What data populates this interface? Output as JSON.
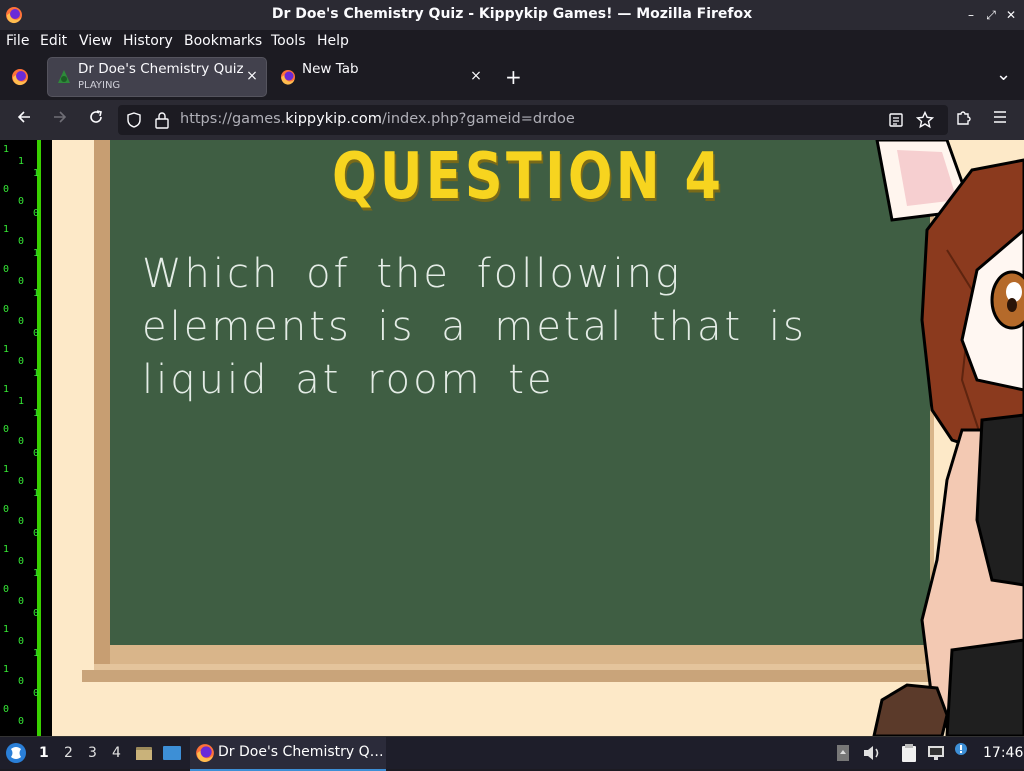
{
  "window": {
    "title": "Dr Doe's Chemistry Quiz - Kippykip Games! — Mozilla Firefox",
    "minimize_glyph": "–",
    "restore_glyph": "⤢",
    "close_glyph": "✕"
  },
  "menu": {
    "file": "File",
    "edit": "Edit",
    "view": "View",
    "history": "History",
    "bookmarks": "Bookmarks",
    "tools": "Tools",
    "help": "Help"
  },
  "tabs": [
    {
      "label": "Dr Doe's Chemistry Quiz",
      "sublabel": "PLAYING",
      "active": true
    },
    {
      "label": "New Tab",
      "active": false
    }
  ],
  "tab_glyphs": {
    "close": "×",
    "new": "+",
    "list": "⌄"
  },
  "nav": {
    "url_prefix": "https://games.",
    "url_host": "kippykip.com",
    "url_suffix": "/index.php?gameid=drdoe"
  },
  "terminal_digits": [
    "1",
    "1",
    "1",
    "0",
    "0",
    "0",
    "1",
    "0",
    "1",
    "0",
    "0",
    "1",
    "0",
    "0",
    "0",
    "1",
    "0",
    "1",
    "1",
    "1",
    "1",
    "0",
    "0",
    "0",
    "1",
    "0",
    "1",
    "0",
    "0",
    "0",
    "1",
    "0",
    "1",
    "0",
    "0",
    "0",
    "1",
    "0",
    "1",
    "1",
    "0",
    "0",
    "0",
    "0"
  ],
  "game": {
    "question_title": "QUESTION 4",
    "question_text": "Which of the following elements is a metal that is liquid at room te"
  },
  "taskbar": {
    "workspaces": [
      "1",
      "2",
      "3",
      "4"
    ],
    "active_task_label": "Dr Doe's Chemistry Q…",
    "clock": "17:46"
  },
  "colors": {
    "chalkboard": "#3f5e43",
    "title_yellow": "#f7d41f",
    "terminal_green": "#35e835"
  }
}
